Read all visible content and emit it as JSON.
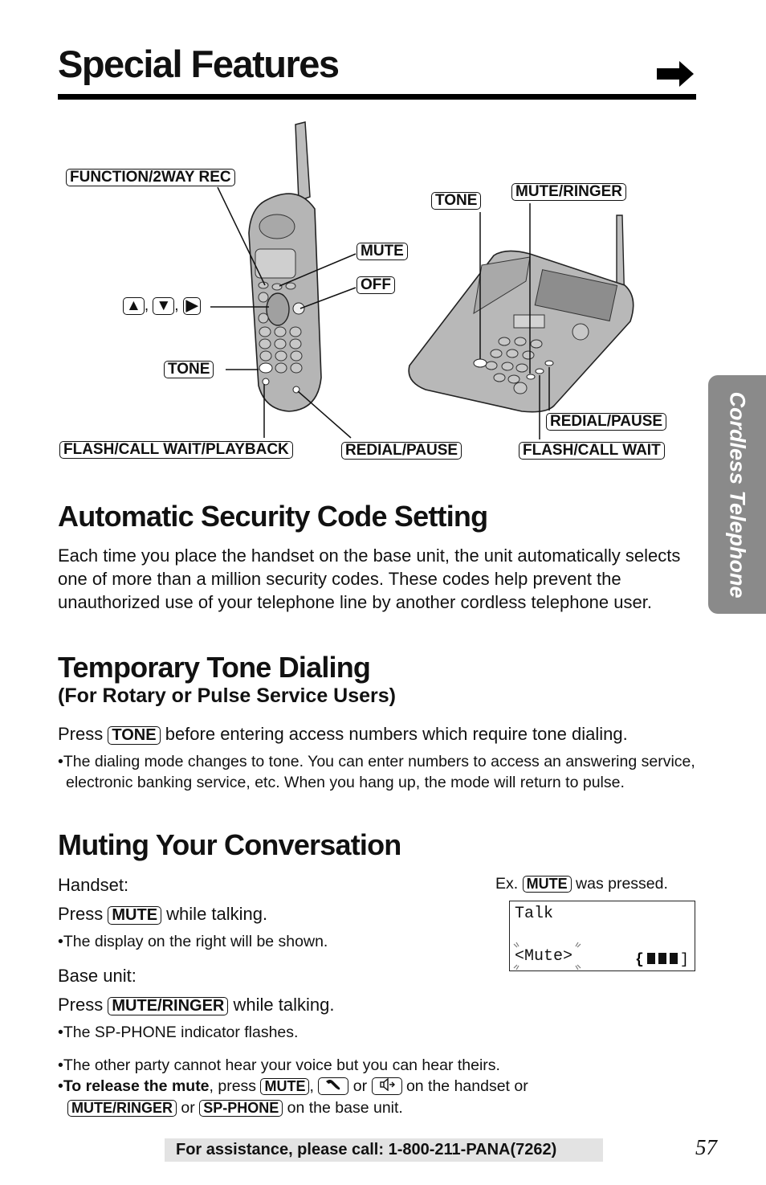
{
  "header": {
    "title": "Special Features",
    "continue_icon": "right-arrow-icon"
  },
  "side_tab": {
    "label": "Cordless Telephone",
    "color": "#8a8a8a"
  },
  "diagram": {
    "handset_labels": {
      "function_2way_rec": "FUNCTION/2WAY REC",
      "mute": "MUTE",
      "off": "OFF",
      "nav_keys": [
        "▲",
        "▼",
        "▶"
      ],
      "nav_separator": ",",
      "tone": "TONE",
      "flash_call_wait_playback": "FLASH/CALL WAIT/PLAYBACK",
      "redial_pause": "REDIAL/PAUSE"
    },
    "base_labels": {
      "tone": "TONE",
      "mute_ringer": "MUTE/RINGER",
      "redial_pause": "REDIAL/PAUSE",
      "flash_call_wait": "FLASH/CALL WAIT"
    }
  },
  "sections": {
    "security": {
      "heading": "Automatic Security Code Setting",
      "body": "Each time you place the handset on the base unit, the unit automatically selects one of more than a million security codes. These codes help prevent the unauthorized use of your telephone line by another cordless telephone user."
    },
    "tone_dialing": {
      "heading": "Temporary Tone Dialing",
      "subheading": "(For Rotary or Pulse Service Users)",
      "press_prefix": "Press",
      "key": "TONE",
      "press_suffix": "before entering access numbers which require tone dialing.",
      "bullet": "The dialing mode changes to tone. You can enter numbers to access an answering service, electronic banking service, etc. When you hang up, the mode will return to pulse."
    },
    "muting": {
      "heading": "Muting Your Conversation",
      "handset_label": "Handset:",
      "handset_press_prefix": "Press",
      "handset_key": "MUTE",
      "handset_press_suffix": "while talking.",
      "handset_bullet": "The display on the right will be shown.",
      "base_label": "Base unit:",
      "base_press_prefix": "Press",
      "base_key": "MUTE/RINGER",
      "base_press_suffix": "while talking.",
      "base_bullet": "The SP-PHONE indicator flashes.",
      "example_prefix": "Ex.",
      "example_key": "MUTE",
      "example_suffix": "was pressed.",
      "display": {
        "line1": "Talk",
        "line2": "<Mute>",
        "battery_icon": "battery-full-icon"
      },
      "note1": "The other party cannot hear your voice but you can hear theirs.",
      "note2_bold": "To release the mute",
      "note2_text1": ", press",
      "note2_key1": "MUTE",
      "note2_comma": ",",
      "note2_or1": "or",
      "note2_text2": "on the handset or",
      "note2_key2": "MUTE/RINGER",
      "note2_or2": "or",
      "note2_key3": "SP-PHONE",
      "note2_text3": "on the base unit.",
      "talk_icon": "phone-talk-icon",
      "speaker_icon": "speakerphone-icon"
    }
  },
  "footer": {
    "assistance": "For assistance, please call: 1-800-211-PANA(7262)",
    "page_number": "57"
  }
}
